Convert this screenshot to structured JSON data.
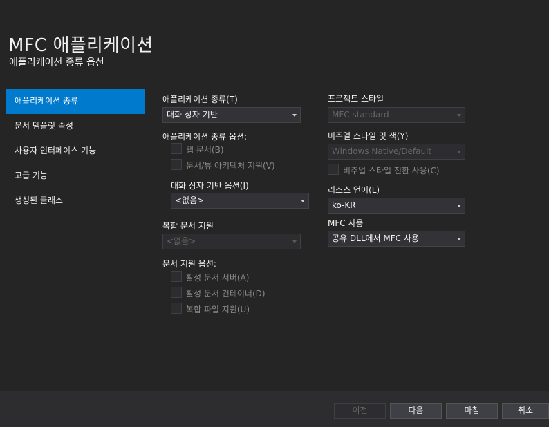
{
  "header": {
    "title": "MFC 애플리케이션",
    "subtitle": "애플리케이션 종류 옵션"
  },
  "sidebar": {
    "items": [
      {
        "label": "애플리케이션 종류",
        "active": true
      },
      {
        "label": "문서 템플릿 속성"
      },
      {
        "label": "사용자 인터페이스 기능"
      },
      {
        "label": "고급 기능"
      },
      {
        "label": "생성된 클래스"
      }
    ]
  },
  "left": {
    "app_type_label": "애플리케이션 종류(T)",
    "app_type_value": "대화 상자 기반",
    "app_type_options_label": "애플리케이션 종류 옵션:",
    "tab_documents": "탭 문서(B)",
    "doc_view_arch": "문서/뷰 아키텍처 지원(V)",
    "dialog_options_label": "대화 상자 기반 옵션(I)",
    "dialog_options_value": "<없음>",
    "compound_doc_label": "복합 문서 지원",
    "compound_doc_value": "<없음>",
    "doc_support_label": "문서 지원 옵션:",
    "active_doc_server": "활성 문서 서버(A)",
    "active_doc_container": "활성 문서 컨테이너(D)",
    "compound_file_support": "복합 파일 지원(U)"
  },
  "right": {
    "project_style_label": "프로젝트 스타일",
    "project_style_value": "MFC standard",
    "visual_style_label": "비주얼 스타일 및 색(Y)",
    "visual_style_value": "Windows Native/Default",
    "visual_style_switch": "비주얼 스타일 전환 사용(C)",
    "resource_lang_label": "리소스 언어(L)",
    "resource_lang_value": "ko-KR",
    "mfc_use_label": "MFC 사용",
    "mfc_use_value": "공유 DLL에서 MFC 사용"
  },
  "footer": {
    "prev": "이전",
    "next": "다음",
    "finish": "마침",
    "cancel": "취소"
  }
}
